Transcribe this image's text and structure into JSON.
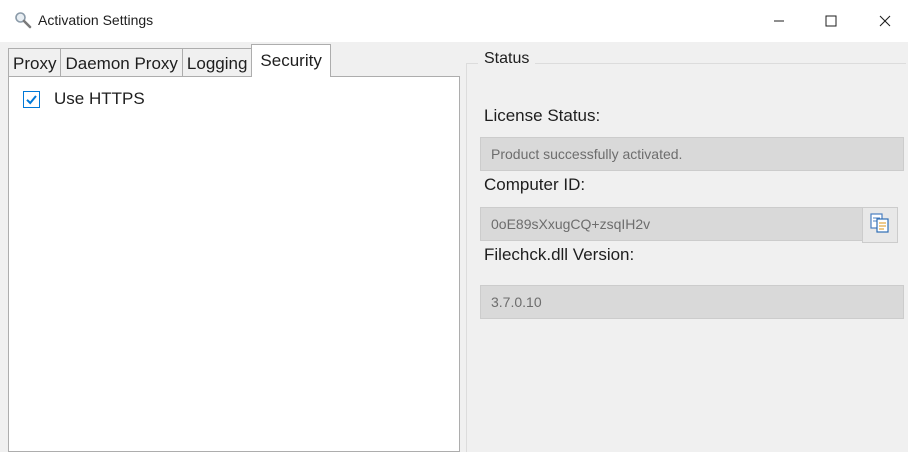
{
  "window": {
    "title": "Activation Settings",
    "app_icon": "magnifier-icon",
    "controls": [
      "minimize-icon",
      "maximize-icon",
      "close-icon"
    ]
  },
  "tabs": [
    {
      "label": "Proxy",
      "active": false
    },
    {
      "label": "Daemon Proxy",
      "active": false
    },
    {
      "label": "Logging",
      "active": false
    },
    {
      "label": "Security",
      "active": true
    }
  ],
  "security": {
    "use_https_label": "Use HTTPS",
    "use_https_checked": true
  },
  "status": {
    "group_title": "Status",
    "license_status_label": "License Status:",
    "license_status_value": "Product successfully activated.",
    "computer_id_label": "Computer ID:",
    "computer_id_value": "0oE89sXxugCQ+zsqIH2v",
    "copy_icon": "copy-icon",
    "dll_version_label": "Filechck.dll Version:",
    "dll_version_value": "3.7.0.10"
  },
  "colors": {
    "accent": "#0078d7",
    "window_bg": "#f0f0f0",
    "readonly_field_bg": "#d9d9d9"
  }
}
